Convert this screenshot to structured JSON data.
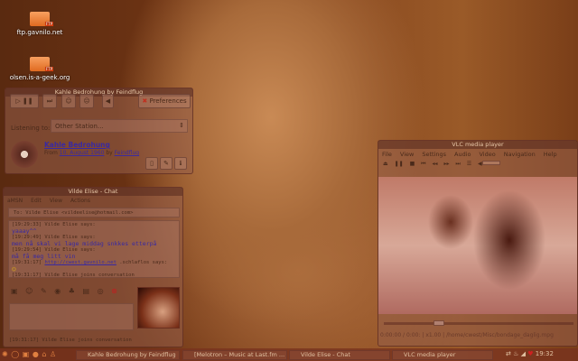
{
  "desktop": {
    "icons": [
      {
        "label": "ftp.gavnilo.net"
      },
      {
        "label": "olsen.is-a-geek.org"
      }
    ]
  },
  "lastfm": {
    "title": "Kahle Bedrohung by Feindflug",
    "preferences": "Preferences",
    "listening_label": "Listening to:",
    "station": "Other Station...",
    "track": "Kahle Bedrohung",
    "from": "From",
    "album": "10. August 1960",
    "by": "by",
    "artist": "Feindflug"
  },
  "chat": {
    "title": "Vilde Elise - Chat",
    "menu": [
      "aMSN",
      "Edit",
      "View",
      "Actions"
    ],
    "to": "To: Vilde Elise <vildeelise@hotmail.com>",
    "messages": [
      {
        "meta": "[19:29:33] Vilde Elise says:",
        "text": "yaaay^^"
      },
      {
        "meta": "[19:29:49] Vilde Elise says:",
        "text": "men nå skal vi lage middag snkkes etterpå"
      },
      {
        "meta": "[19:29:54] Vilde Elise says:",
        "text": "må få meg litt vin"
      }
    ],
    "link_time": "[19:31:17]",
    "link": "http://cwest.gavnilo.net",
    "link_after": ".schlaflos says:",
    "join": "[19:31:17] Vilde Elise joins conversation",
    "status": "[19:31:17] Vilde Elise joins conversation"
  },
  "vlc": {
    "title": "VLC media player",
    "menu": [
      "File",
      "View",
      "Settings",
      "Audio",
      "Video",
      "Navigation",
      "Help"
    ],
    "time": "0:00:00 / 0:00:",
    "speed": "x1.00",
    "file": "/home/cwest/Misc/bondage_daglig.mpg",
    "seek_fraction": 0.28
  },
  "taskbar": {
    "tasks": [
      "Kahle Bedrohung by Feindflug",
      "[Melotron – Music at Last.fm ...",
      "Vilde Elise - Chat",
      "VLC media player"
    ],
    "clock": "19:32"
  }
}
